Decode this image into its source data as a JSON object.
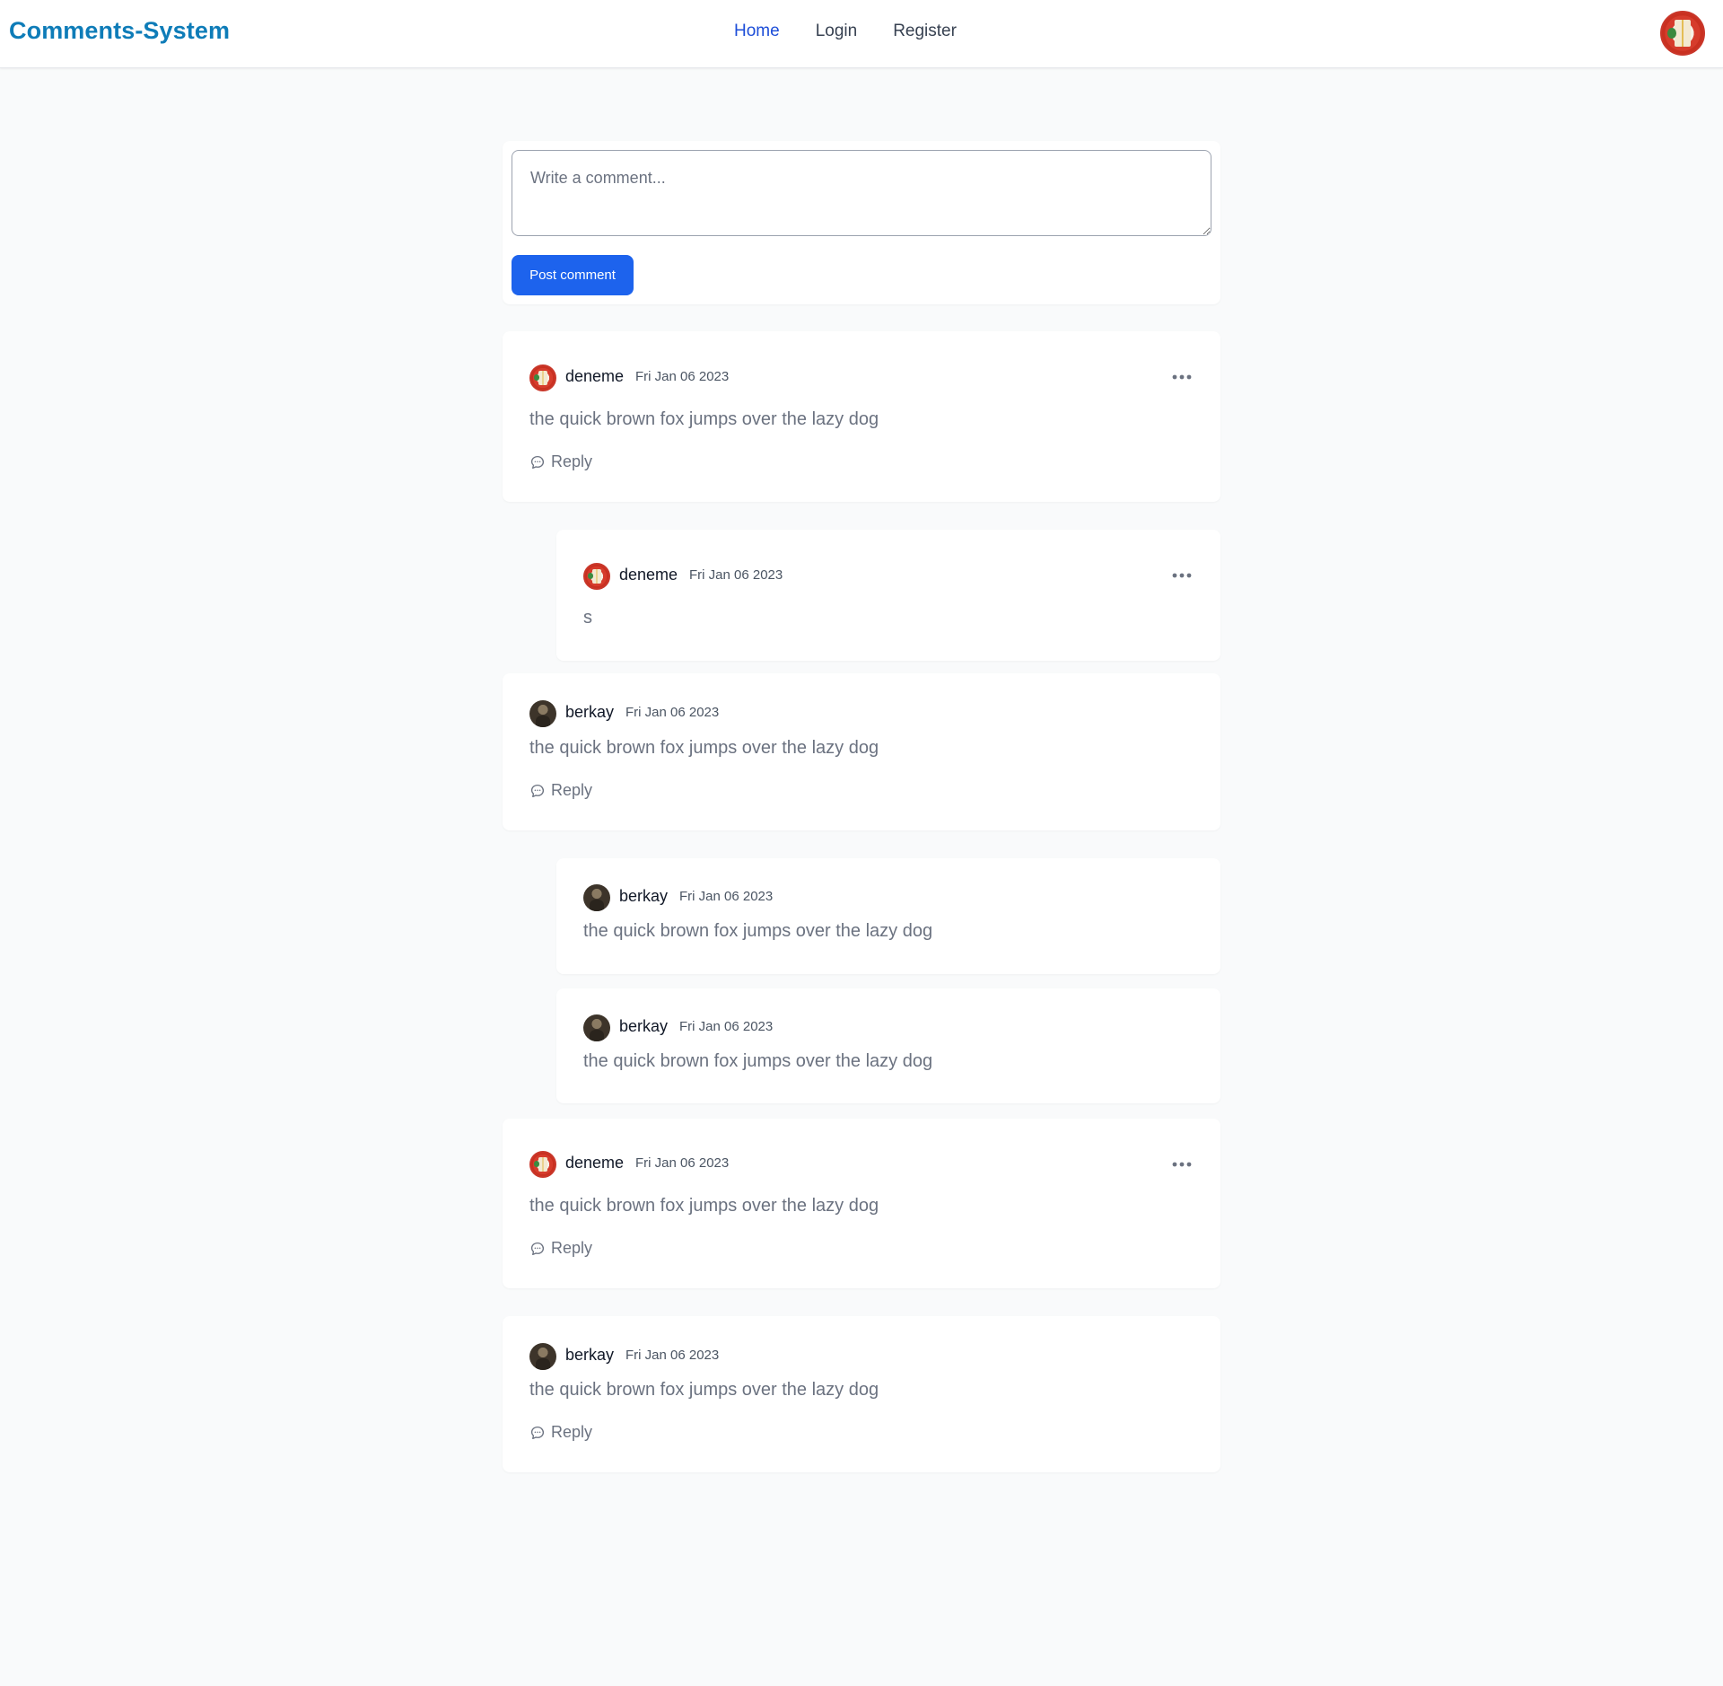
{
  "navbar": {
    "brand": "Comments-System",
    "links": [
      {
        "label": "Home",
        "active": true
      },
      {
        "label": "Login",
        "active": false
      },
      {
        "label": "Register",
        "active": false
      }
    ],
    "avatar_icon": "user-avatar-icon"
  },
  "composer": {
    "placeholder": "Write a comment...",
    "value": "",
    "post_label": "Post comment"
  },
  "reply_label": "Reply",
  "comments": [
    {
      "author": "deneme",
      "date": "Fri Jan 06 2023",
      "body": "the quick brown fox jumps over the lazy dog",
      "has_menu": true,
      "has_reply": true
    },
    {
      "author": "deneme",
      "date": "Fri Jan 06 2023",
      "body": "s",
      "has_menu": true,
      "has_reply": false
    },
    {
      "author": "berkay",
      "date": "Fri Jan 06 2023",
      "body": "the quick brown fox jumps over the lazy dog",
      "has_menu": false,
      "has_reply": true
    },
    {
      "author": "berkay",
      "date": "Fri Jan 06 2023",
      "body": "the quick brown fox jumps over the lazy dog",
      "has_menu": false,
      "has_reply": false
    },
    {
      "author": "berkay",
      "date": "Fri Jan 06 2023",
      "body": "the quick brown fox jumps over the lazy dog",
      "has_menu": false,
      "has_reply": false
    },
    {
      "author": "deneme",
      "date": "Fri Jan 06 2023",
      "body": "the quick brown fox jumps over the lazy dog",
      "has_menu": true,
      "has_reply": true
    },
    {
      "author": "berkay",
      "date": "Fri Jan 06 2023",
      "body": "the quick brown fox jumps over the lazy dog",
      "has_menu": false,
      "has_reply": true
    }
  ],
  "colors": {
    "brand": "#0e7cb8",
    "nav_active": "#1d4ed8",
    "primary_button": "#1d63ed",
    "page_background": "#f9fafb",
    "card_background": "#ffffff"
  }
}
